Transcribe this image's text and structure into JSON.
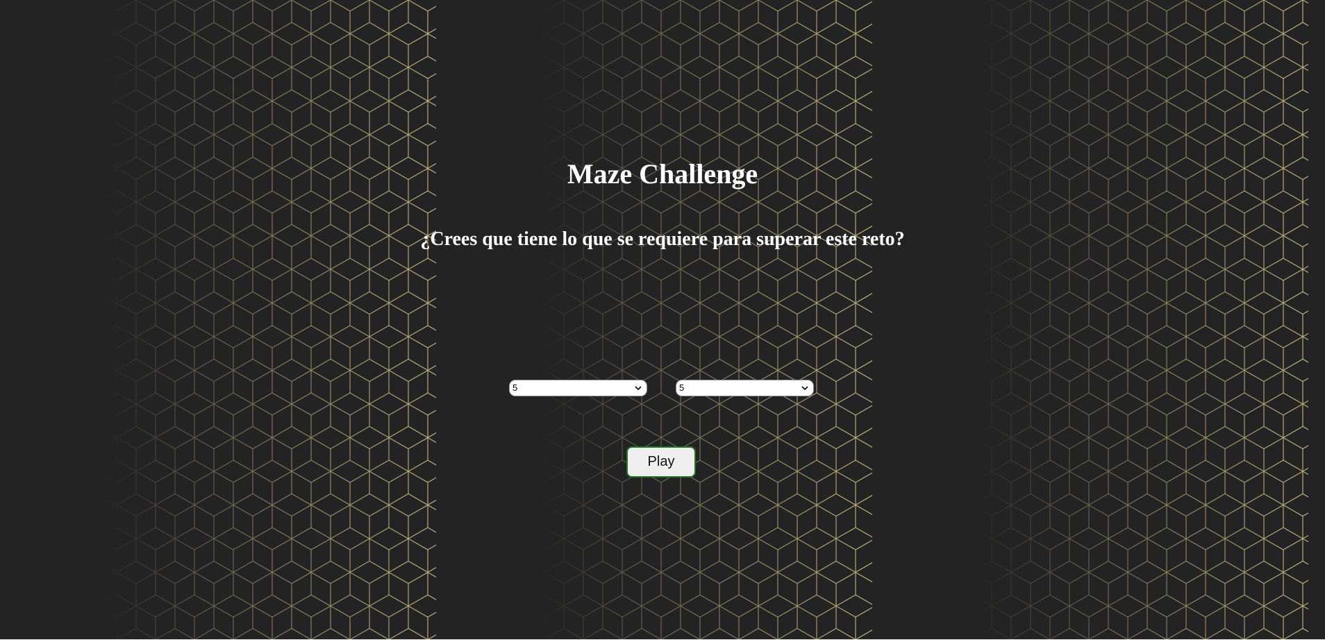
{
  "page": {
    "title": "Maze Challenge",
    "subtitle": "¿Crees que tiene lo que se requiere para superar este reto?"
  },
  "controls": {
    "rows_select": {
      "value": "5"
    },
    "cols_select": {
      "value": "5"
    },
    "play_label": "Play"
  },
  "colors": {
    "background": "#232323",
    "pattern_line": "#d9c88c",
    "text": "#ffffff",
    "button_border": "#1e7a1e",
    "button_bg": "#efefef"
  },
  "icons": {
    "select_arrow": "chevron-down-icon"
  }
}
